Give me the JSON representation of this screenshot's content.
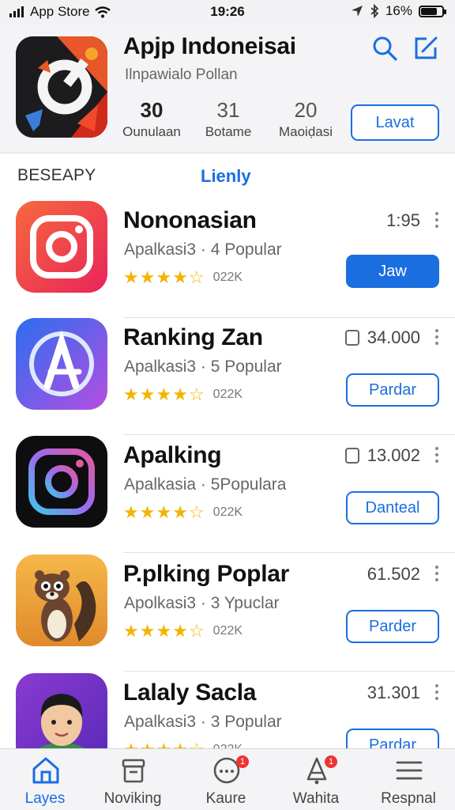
{
  "status_bar": {
    "carrier": "App Store",
    "time": "19:26",
    "battery": "16%"
  },
  "header": {
    "title": "Apjp Indoneisai",
    "subtitle": "Ilnpawialo Pollan",
    "stats": [
      {
        "value": "30",
        "label": "Ounulaan"
      },
      {
        "value": "31",
        "label": "Botame"
      },
      {
        "value": "20",
        "label": "Maoiḍasi"
      }
    ],
    "action_label": "Lavat",
    "search_icon": "search-icon",
    "compose_icon": "compose-icon",
    "accent": "#1a6ee0"
  },
  "section": {
    "left_label": "BESEAPY",
    "right_label": "Lienly"
  },
  "apps": [
    {
      "name": "Nononasian",
      "category": "Apalkasi3 · 4 Popular",
      "rating": 4,
      "rating_count": "022K",
      "meta": "1:95",
      "has_box": false,
      "button": "Jaw",
      "button_style": "solid",
      "icon": "instagram-orange-icon"
    },
    {
      "name": "Ranking Zan",
      "category": "Apalkasi3 · 5 Popular",
      "rating": 4,
      "rating_count": "022K",
      "meta": "34.000",
      "has_box": true,
      "button": "Pardar",
      "button_style": "outline",
      "icon": "app-store-a-icon"
    },
    {
      "name": "Apalking",
      "category": "Apalkasia · 5Populara",
      "rating": 4,
      "rating_count": "022K",
      "meta": "13.002",
      "has_box": true,
      "button": "Danteal",
      "button_style": "outline",
      "icon": "instagram-dark-icon"
    },
    {
      "name": "P.plking Poplar",
      "category": "Apolkasi3 · 3 Ypuclar",
      "rating": 4,
      "rating_count": "022K",
      "meta": "61.502",
      "has_box": false,
      "button": "Parder",
      "button_style": "outline",
      "icon": "squirrel-icon"
    },
    {
      "name": "Lalaly Sacla",
      "category": "Apalkasi3 · 3 Popular",
      "rating": 4,
      "rating_count": "022K",
      "meta": "31.301",
      "has_box": false,
      "button": "Pardar",
      "button_style": "outline",
      "icon": "avatar-boy-icon"
    }
  ],
  "tab_bar": [
    {
      "label": "Layes",
      "icon": "home-icon",
      "active": true,
      "badge": ""
    },
    {
      "label": "Noviking",
      "icon": "archive-icon",
      "active": false,
      "badge": ""
    },
    {
      "label": "Kaure",
      "icon": "chat-icon",
      "active": false,
      "badge": "1"
    },
    {
      "label": "Wahita",
      "icon": "bell-icon",
      "active": false,
      "badge": "1"
    },
    {
      "label": "Respnal",
      "icon": "menu-icon",
      "active": false,
      "badge": ""
    }
  ]
}
